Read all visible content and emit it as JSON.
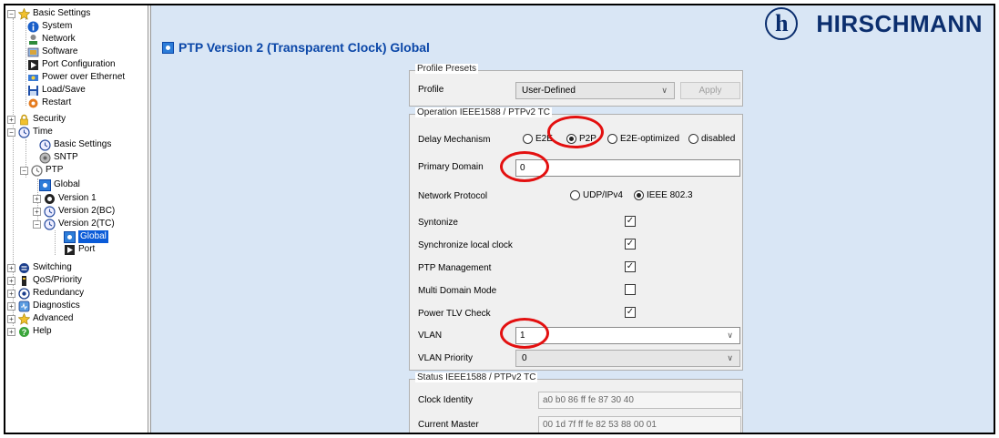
{
  "sidebar": {
    "items": [
      {
        "label": "Basic Settings",
        "expander": "−",
        "icon": "star-icon"
      },
      {
        "label": "System",
        "icon": "info-icon"
      },
      {
        "label": "Network",
        "icon": "network-icon"
      },
      {
        "label": "Software",
        "icon": "software-icon"
      },
      {
        "label": "Port Configuration",
        "icon": "port-icon"
      },
      {
        "label": "Power over Ethernet",
        "icon": "poe-icon"
      },
      {
        "label": "Load/Save",
        "icon": "save-icon"
      },
      {
        "label": "Restart",
        "icon": "restart-icon"
      },
      {
        "label": "Security",
        "expander": "+",
        "icon": "lock-icon"
      },
      {
        "label": "Time",
        "expander": "−",
        "icon": "clock-icon"
      },
      {
        "label": "Basic Settings",
        "icon": "clock-icon"
      },
      {
        "label": "SNTP",
        "icon": "sntp-icon"
      },
      {
        "label": "PTP",
        "expander": "−",
        "icon": "ptp-icon"
      },
      {
        "label": "Global",
        "icon": "global-icon"
      },
      {
        "label": "Version 1",
        "expander": "+",
        "icon": "gear-icon"
      },
      {
        "label": "Version 2(BC)",
        "expander": "+",
        "icon": "clock-icon"
      },
      {
        "label": "Version 2(TC)",
        "expander": "−",
        "icon": "clock-icon"
      },
      {
        "label": "Global",
        "icon": "global-icon",
        "selected": true
      },
      {
        "label": "Port",
        "icon": "port-icon"
      },
      {
        "label": "Switching",
        "expander": "+",
        "icon": "switching-icon"
      },
      {
        "label": "QoS/Priority",
        "expander": "+",
        "icon": "qos-icon"
      },
      {
        "label": "Redundancy",
        "expander": "+",
        "icon": "redundancy-icon"
      },
      {
        "label": "Diagnostics",
        "expander": "+",
        "icon": "diagnostics-icon"
      },
      {
        "label": "Advanced",
        "expander": "+",
        "icon": "star-icon"
      },
      {
        "label": "Help",
        "expander": "+",
        "icon": "help-icon"
      }
    ]
  },
  "header": {
    "title": "PTP Version 2 (Transparent Clock) Global",
    "brand": "HIRSCHMANN",
    "logo_glyph": "h"
  },
  "presets": {
    "group_label": "Profile Presets",
    "profile_label": "Profile",
    "profile_value": "User-Defined",
    "apply_label": "Apply"
  },
  "operation": {
    "group_label": "Operation IEEE1588 / PTPv2 TC",
    "delay_label": "Delay Mechanism",
    "delay_options": [
      "E2E",
      "P2P",
      "E2E-optimized",
      "disabled"
    ],
    "delay_selected": "P2P",
    "primary_domain_label": "Primary Domain",
    "primary_domain_value": "0",
    "network_protocol_label": "Network Protocol",
    "protocol_options": [
      "UDP/IPv4",
      "IEEE 802.3"
    ],
    "protocol_selected": "IEEE 802.3",
    "syntonize_label": "Syntonize",
    "sync_local_clock_label": "Synchronize local clock",
    "ptp_management_label": "PTP Management",
    "multi_domain_label": "Multi Domain Mode",
    "power_tlv_label": "Power TLV Check",
    "checks": {
      "syntonize": true,
      "sync_local_clock": true,
      "ptp_management": true,
      "multi_domain": false,
      "power_tlv": true
    },
    "check_glyph": "✓",
    "vlan_label": "VLAN",
    "vlan_value": "1",
    "vlan_priority_label": "VLAN Priority",
    "vlan_priority_value": "0"
  },
  "status": {
    "group_label": "Status IEEE1588 / PTPv2 TC",
    "clock_identity_label": "Clock Identity",
    "clock_identity_value": "a0 b0 86 ff fe 87 30 40",
    "current_master_label": "Current Master",
    "current_master_value": "00 1d 7f ff fe 82 53 88 00 01"
  },
  "annotation_color": "#e31010",
  "colors": {
    "accent": "#0b47a8",
    "background": "#d9e6f5",
    "brand": "#0b2e6e"
  }
}
